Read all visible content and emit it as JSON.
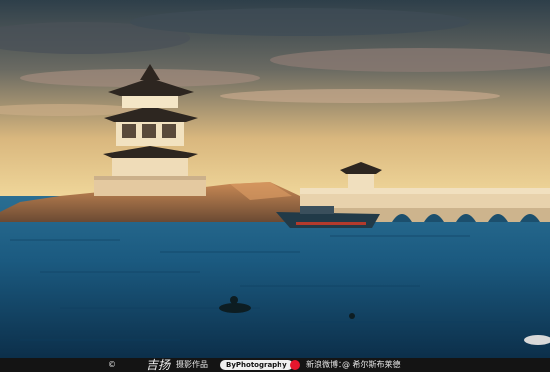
{
  "scene": {
    "sky_top": "#3a4a55",
    "sky_glow": "#e8c58a",
    "sea": "#1b5a80",
    "sea_deep": "#0d3552",
    "stone": "#d9b98a"
  },
  "footer": {
    "copyright": "©",
    "signature": "吉扬",
    "work_label": "摄影作品",
    "brand_pill": "ByPhotography",
    "separator": "|",
    "weibo_icon": "weibo-icon",
    "weibo_label": "新浪微博：",
    "weibo_handle": "@ 希尔斯布莱德"
  }
}
